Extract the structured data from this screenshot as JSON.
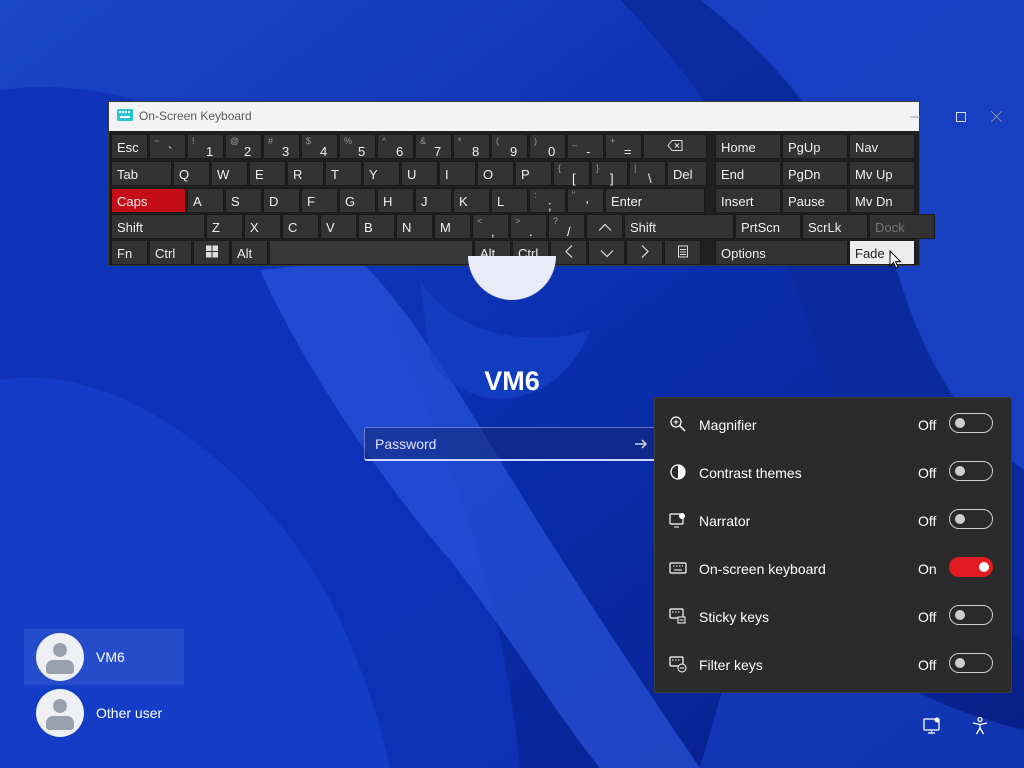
{
  "osk": {
    "title": "On-Screen Keyboard",
    "rows": [
      [
        {
          "label": "Esc"
        },
        {
          "sec": "~",
          "pri": "`"
        },
        {
          "sec": "!",
          "pri": "1"
        },
        {
          "sec": "@",
          "pri": "2"
        },
        {
          "sec": "#",
          "pri": "3"
        },
        {
          "sec": "$",
          "pri": "4"
        },
        {
          "sec": "%",
          "pri": "5"
        },
        {
          "sec": "^",
          "pri": "6"
        },
        {
          "sec": "&",
          "pri": "7"
        },
        {
          "sec": "*",
          "pri": "8"
        },
        {
          "sec": "(",
          "pri": "9"
        },
        {
          "sec": ")",
          "pri": "0"
        },
        {
          "sec": "_",
          "pri": "-"
        },
        {
          "sec": "+",
          "pri": "="
        },
        {
          "icon": "backspace-icon"
        },
        {
          "label": "Home"
        },
        {
          "label": "PgUp"
        },
        {
          "label": "Nav"
        }
      ],
      [
        {
          "label": "Tab"
        },
        {
          "label": "Q"
        },
        {
          "label": "W"
        },
        {
          "label": "E"
        },
        {
          "label": "R"
        },
        {
          "label": "T"
        },
        {
          "label": "Y"
        },
        {
          "label": "U"
        },
        {
          "label": "I"
        },
        {
          "label": "O"
        },
        {
          "label": "P"
        },
        {
          "sec": "{",
          "pri": "["
        },
        {
          "sec": "}",
          "pri": "]"
        },
        {
          "sec": "|",
          "pri": "\\"
        },
        {
          "label": "Del"
        },
        {
          "label": "End"
        },
        {
          "label": "PgDn"
        },
        {
          "label": "Mv Up"
        }
      ],
      [
        {
          "label": "Caps",
          "state": "active"
        },
        {
          "label": "A"
        },
        {
          "label": "S"
        },
        {
          "label": "D"
        },
        {
          "label": "F"
        },
        {
          "label": "G"
        },
        {
          "label": "H"
        },
        {
          "label": "J"
        },
        {
          "label": "K"
        },
        {
          "label": "L"
        },
        {
          "sec": ":",
          "pri": ";"
        },
        {
          "sec": "\"",
          "pri": "'"
        },
        {
          "label": "Enter"
        },
        {
          "label": "Insert"
        },
        {
          "label": "Pause"
        },
        {
          "label": "Mv Dn"
        }
      ],
      [
        {
          "label": "Shift"
        },
        {
          "label": "Z"
        },
        {
          "label": "X"
        },
        {
          "label": "C"
        },
        {
          "label": "V"
        },
        {
          "label": "B"
        },
        {
          "label": "N"
        },
        {
          "label": "M"
        },
        {
          "sec": "<",
          "pri": ","
        },
        {
          "sec": ">",
          "pri": "."
        },
        {
          "sec": "?",
          "pri": "/"
        },
        {
          "icon": "up-arrow-icon"
        },
        {
          "label": "Shift"
        },
        {
          "label": "PrtScn"
        },
        {
          "label": "ScrLk"
        },
        {
          "label": "Dock",
          "state": "disabled"
        }
      ],
      [
        {
          "label": "Fn"
        },
        {
          "label": "Ctrl"
        },
        {
          "icon": "windows-icon"
        },
        {
          "label": "Alt"
        },
        {
          "label": "",
          "role": "space"
        },
        {
          "label": "Alt"
        },
        {
          "label": "Ctrl"
        },
        {
          "icon": "left-arrow-icon"
        },
        {
          "icon": "down-arrow-icon"
        },
        {
          "icon": "right-arrow-icon"
        },
        {
          "icon": "menu-icon"
        },
        {
          "label": "Options"
        },
        {
          "label": "Fade",
          "state": "hover"
        }
      ]
    ]
  },
  "login": {
    "username": "VM6",
    "password_placeholder": "Password"
  },
  "accessibility": {
    "items": [
      {
        "icon": "magnifier-icon",
        "label": "Magnifier",
        "state": "Off",
        "on": false
      },
      {
        "icon": "contrast-themes-icon",
        "label": "Contrast themes",
        "state": "Off",
        "on": false
      },
      {
        "icon": "narrator-icon",
        "label": "Narrator",
        "state": "Off",
        "on": false
      },
      {
        "icon": "keyboard-icon",
        "label": "On-screen keyboard",
        "state": "On",
        "on": true
      },
      {
        "icon": "sticky-keys-icon",
        "label": "Sticky keys",
        "state": "Off",
        "on": false
      },
      {
        "icon": "filter-keys-icon",
        "label": "Filter keys",
        "state": "Off",
        "on": false
      }
    ],
    "accent": "#e31b23"
  },
  "users": [
    {
      "name": "VM6",
      "selected": true
    },
    {
      "name": "Other user",
      "selected": false
    }
  ],
  "system_icons": [
    "network-icon",
    "accessibility-icon"
  ]
}
